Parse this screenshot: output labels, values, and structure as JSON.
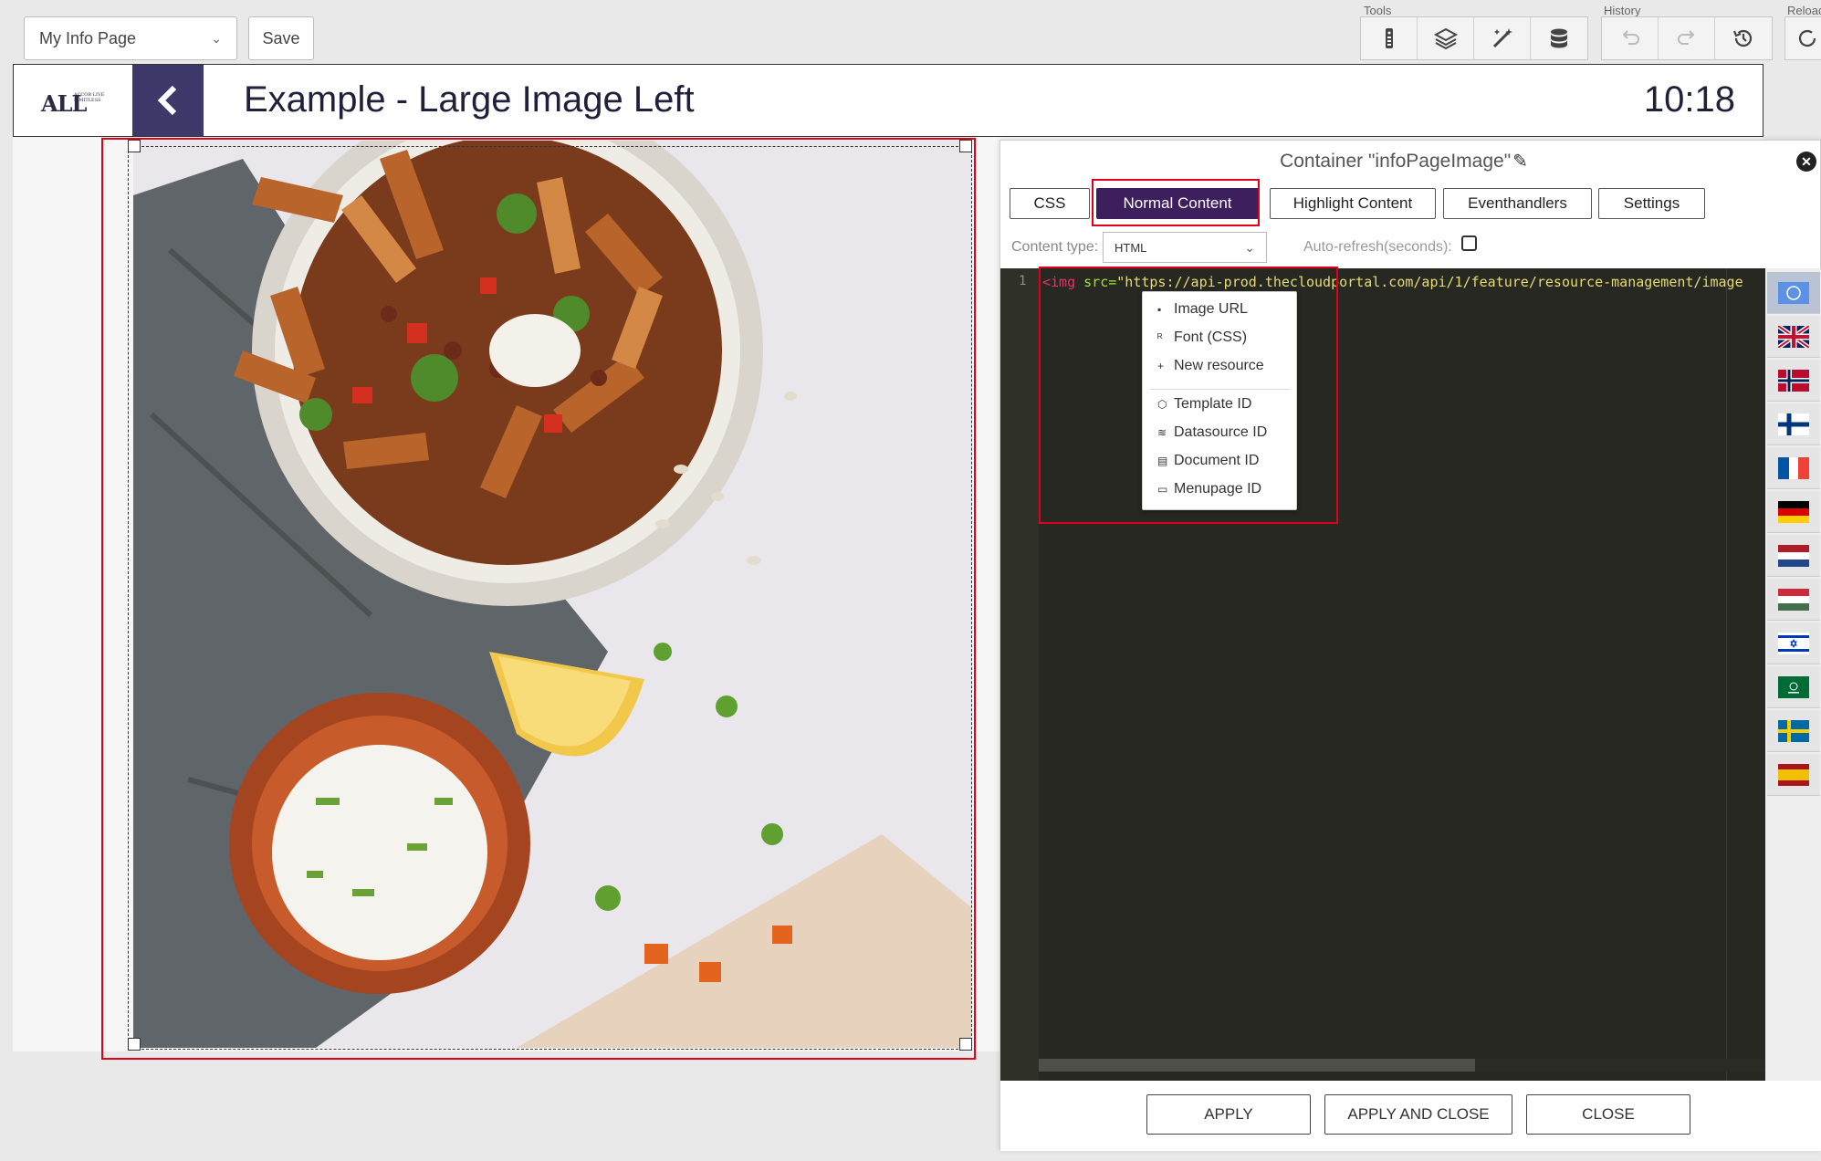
{
  "toolbar": {
    "page_select": "My Info Page",
    "save_label": "Save",
    "tools_label": "Tools",
    "history_label": "History",
    "reload_label": "Reload",
    "tool_icons": [
      "remote-icon",
      "layers-icon",
      "magic-wand-icon",
      "database-icon"
    ],
    "history_icons": [
      "undo-icon",
      "redo-icon",
      "history-clock-icon"
    ]
  },
  "header": {
    "logo_text": "ALL",
    "logo_tagline": "ACCOR LIVE LIMITLESS",
    "title": "Example - Large Image Left",
    "time": "10:18"
  },
  "panel": {
    "title": "Container \"infoPageImage\"",
    "tabs": [
      "CSS",
      "Normal Content",
      "Highlight Content",
      "Eventhandlers",
      "Settings"
    ],
    "active_tab": "Normal Content",
    "content_type_label": "Content type:",
    "content_type_value": "HTML",
    "auto_refresh_label": "Auto-refresh(seconds):",
    "editor": {
      "line_number": "1",
      "code_tag": "<img",
      "code_attr": " src=",
      "code_string": "\"https://api-prod.thecloudportal.com/api/1/feature/resource-management/image"
    },
    "context_menu": [
      {
        "icon": "▪",
        "label": "Image URL"
      },
      {
        "icon": "ᴿ",
        "label": "Font (CSS)"
      },
      {
        "icon": "+",
        "label": "New resource"
      },
      {
        "icon": "⬡",
        "label": "Template ID"
      },
      {
        "icon": "≋",
        "label": "Datasource ID"
      },
      {
        "icon": "▤",
        "label": "Document ID"
      },
      {
        "icon": "▭",
        "label": "Menupage ID"
      }
    ],
    "languages": [
      "un",
      "gb",
      "no",
      "fi",
      "fr",
      "de",
      "nl",
      "hu",
      "il",
      "sa",
      "se",
      "es"
    ],
    "buttons": {
      "apply": "APPLY",
      "apply_close": "APPLY AND CLOSE",
      "close": "CLOSE"
    }
  },
  "colors": {
    "accent": "#3d1f5e",
    "header_button": "#3d3a6b",
    "highlight": "#e0001a",
    "editor_bg": "#272822"
  }
}
